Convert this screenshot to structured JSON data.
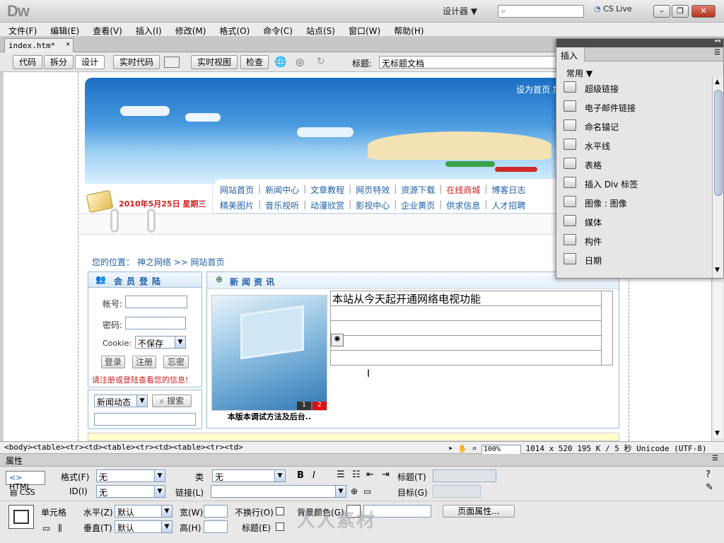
{
  "app": {
    "logo": "Dw",
    "workspace": "设计器 ▼",
    "cslive": "CS Live",
    "window_buttons": [
      "–",
      "❐",
      "✕"
    ]
  },
  "menu": [
    "文件(F)",
    "编辑(E)",
    "查看(V)",
    "插入(I)",
    "修改(M)",
    "格式(O)",
    "命令(C)",
    "站点(S)",
    "窗口(W)",
    "帮助(H)"
  ],
  "document_tab": "index.htm*",
  "toolbar": {
    "code": "代码",
    "split": "拆分",
    "design": "设计",
    "live_code": "实时代码",
    "live_view": "实时视图",
    "inspect": "检查",
    "title_label": "标题:",
    "title_value": "无标题文档"
  },
  "page": {
    "banner_links": "设为首页   加入收藏   站内留",
    "date": "2010年5月25日   星期三",
    "nav_row1": [
      "网站首页",
      "新闻中心",
      "文章教程",
      "网页特效",
      "资源下载",
      "在线商城",
      "博客日志"
    ],
    "nav_row2": [
      "精美图片",
      "音乐视听",
      "动漫欣赏",
      "影视中心",
      "企业黄页",
      "供求信息",
      "人才招聘"
    ],
    "location": "您的位置： 神之网络 >> 网站首页",
    "login": {
      "header": "会员登陆",
      "account_label": "帐号:",
      "password_label": "密码:",
      "cookie_label": "Cookie:",
      "cookie_value": "不保存",
      "login_btn": "登录",
      "register_btn": "注册",
      "forgot_btn": "忘密",
      "note": "请注册或登陆查看您的信息!"
    },
    "search": {
      "select": "新闻动态",
      "button": "搜索"
    },
    "news": {
      "header": "新闻资讯",
      "first_item": "本站从今天起开通网络电视功能",
      "caption": "本版本调试方法及后台..",
      "pager": [
        "1",
        "2"
      ]
    }
  },
  "insert_panel": {
    "tab": "插入",
    "category": "常用",
    "items": [
      "超级链接",
      "电子邮件链接",
      "命名锚记",
      "水平线",
      "表格",
      "插入 Div 标签",
      "图像 : 图像",
      "媒体",
      "构件",
      "日期"
    ]
  },
  "status": {
    "tags": "<body><table><tr><td><table><tr><td><table><tr><td>",
    "zoom": "100%",
    "size": "1014 x 520",
    "weight": "195 K / 5 秒",
    "encoding": "Unicode (UTF-8)"
  },
  "properties": {
    "title": "属性",
    "html_btn": "HTML",
    "css_btn": "CSS",
    "format_label": "格式(F)",
    "format_value": "无",
    "class_label": "类",
    "class_value": "无",
    "id_label": "ID(I)",
    "id_value": "无",
    "link_label": "链接(L)",
    "title_label": "标题(T)",
    "target_label": "目标(G)",
    "cell_label": "单元格",
    "horz_label": "水平(Z)",
    "horz_value": "默认",
    "vert_label": "垂直(T)",
    "vert_value": "默认",
    "width_label": "宽(W)",
    "height_label": "高(H)",
    "nowrap_label": "不换行(O)",
    "header_label": "标题(E)",
    "bg_label": "背景颜色(G)",
    "page_props": "页面属性..."
  },
  "watermark": "人人素材"
}
